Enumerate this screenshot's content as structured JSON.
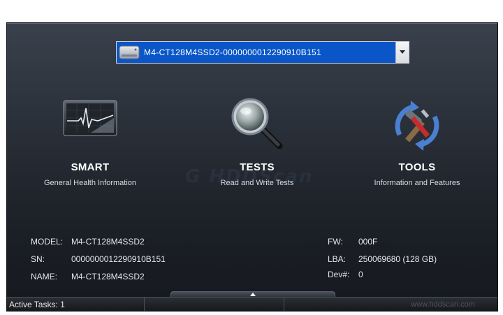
{
  "drive_selector": {
    "value": "M4-CT128M4SSD2-0000000012290910B151",
    "icon": "hard-drive-icon"
  },
  "actions": [
    {
      "title": "SMART",
      "subtitle": "General Health Information",
      "icon": "heart-monitor-icon"
    },
    {
      "title": "TESTS",
      "subtitle": "Read and Write Tests",
      "icon": "magnifier-icon"
    },
    {
      "title": "TOOLS",
      "subtitle": "Information and Features",
      "icon": "tools-icon"
    }
  ],
  "drive_info": {
    "model_label": "MODEL:",
    "model": "M4-CT128M4SSD2",
    "sn_label": "SN:",
    "sn": "0000000012290910B151",
    "name_label": "NAME:",
    "name": "M4-CT128M4SSD2",
    "fw_label": "FW:",
    "fw": "000F",
    "lba_label": "LBA:",
    "lba": "250069680 (128 GB)",
    "dev_label": "Dev#:",
    "dev": "0"
  },
  "status_bar": {
    "active_tasks": "Active Tasks: 1",
    "website": "www.hddscan.com"
  },
  "colors": {
    "accent": "#0a56c8",
    "background_top": "#3a414c",
    "background_bottom": "#15181d"
  }
}
